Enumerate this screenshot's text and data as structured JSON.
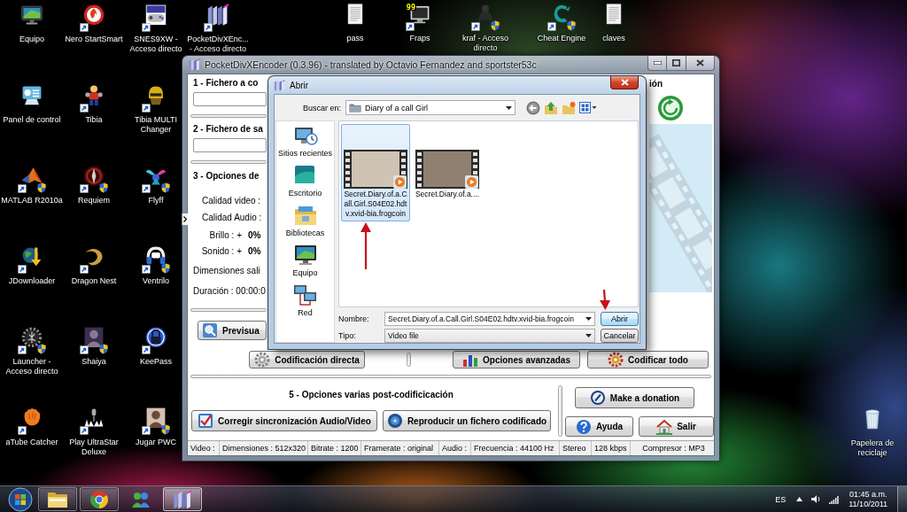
{
  "desktop_icons": [
    {
      "label": "Equipo",
      "shortcut": false,
      "shield": false
    },
    {
      "label": "Panel de control",
      "shortcut": false,
      "shield": false
    },
    {
      "label": "MATLAB R2010a",
      "shortcut": true,
      "shield": true
    },
    {
      "label": "JDownloader",
      "shortcut": true,
      "shield": false
    },
    {
      "label": "Launcher - Acceso directo",
      "shortcut": true,
      "shield": true
    },
    {
      "label": "aTube Catcher",
      "shortcut": true,
      "shield": false
    },
    {
      "label": "Nero StartSmart",
      "shortcut": true,
      "shield": false
    },
    {
      "label": "Tibia",
      "shortcut": true,
      "shield": false
    },
    {
      "label": "Requiem",
      "shortcut": true,
      "shield": true
    },
    {
      "label": "Dragon Nest",
      "shortcut": true,
      "shield": false
    },
    {
      "label": "Shaiya",
      "shortcut": true,
      "shield": true
    },
    {
      "label": "Play UltraStar Deluxe",
      "shortcut": true,
      "shield": false
    },
    {
      "label": "SNES9XW - Acceso directo",
      "shortcut": true,
      "shield": false
    },
    {
      "label": "Tibia MULTI Changer",
      "shortcut": true,
      "shield": false
    },
    {
      "label": "Flyff",
      "shortcut": true,
      "shield": true
    },
    {
      "label": "Ventrilo",
      "shortcut": true,
      "shield": true
    },
    {
      "label": "KeePass",
      "shortcut": true,
      "shield": false
    },
    {
      "label": "Jugar PWC",
      "shortcut": true,
      "shield": true
    },
    {
      "label": "PocketDivXEnc... - Acceso directo",
      "shortcut": true,
      "shield": false
    }
  ],
  "top_icons": [
    {
      "label": "pass",
      "shortcut": false,
      "shield": false
    },
    {
      "label": "Fraps",
      "badge": "99",
      "shortcut": true,
      "shield": false
    },
    {
      "label": "kraf - Acceso directo",
      "shortcut": true,
      "shield": true
    },
    {
      "label": "Cheat Engine",
      "shortcut": true,
      "shield": true
    },
    {
      "label": "claves",
      "shortcut": false,
      "shield": false
    }
  ],
  "main_window": {
    "title": "PocketDivXEncoder (0.3.96) - translated by Octavio Fernandez and sportster53c",
    "file_sections": [
      {
        "heading": "1 - Fichero a co"
      },
      {
        "heading": "2 - Fichero de sa"
      }
    ],
    "options": {
      "heading": "3 - Opciones de",
      "quality_rows": [
        "Calidad video :",
        "Calidad Audio :"
      ],
      "adjust_rows": [
        {
          "label": "Brillo : +",
          "value": "0%"
        },
        {
          "label": "Sonido : +",
          "value": "0%"
        }
      ],
      "info_rows": [
        "Dimensiones sali",
        "Duración : 00:00:0"
      ]
    },
    "preview_button": "Previsua",
    "queue_heading": "ión",
    "action_buttons": [
      "Codificación directa",
      "Opciones avanzadas",
      "Codificar todo"
    ],
    "post_heading": "5 - Opciones varias post-codificicación",
    "post_buttons": [
      "Corregir sincronización Audio/Video",
      "Reproducir un fichero codificado"
    ],
    "donate_button": "Make a donation",
    "help_button": "Ayuda",
    "exit_button": "Salir",
    "status_bar": [
      "Video :",
      "Dimensiones : 512x320",
      "Bitrate : 1200",
      "Framerate : original",
      "Audio :",
      "Frecuencia : 44100 Hz",
      "Stereo",
      "128 kbps",
      "Compresor : MP3"
    ]
  },
  "open_dialog": {
    "title": "Abrir",
    "look_in": {
      "label": "Buscar en:",
      "value": "Diary of a call Girl"
    },
    "places": [
      "Sitios recientes",
      "Escritorio",
      "Bibliotecas",
      "Equipo",
      "Red"
    ],
    "files": [
      {
        "name": "Secret.Diary.of.a.Call.Girl.S04E02.hdtv.xvid-bia.frogcoin",
        "selected": true
      },
      {
        "name": "Secret.Diary.of.a....",
        "selected": false
      }
    ],
    "file_name": {
      "label": "Nombre:",
      "value": "Secret.Diary.of.a.Call.Girl.S04E02.hdtv.xvid-bia.frogcoin"
    },
    "file_type": {
      "label": "Tipo:",
      "value": "Video file"
    },
    "buttons": [
      {
        "label": "Abrir",
        "default": true
      },
      {
        "label": "Cancelar",
        "default": false
      }
    ]
  },
  "recycle_bin": {
    "label": "Papelera de reciclaje"
  },
  "taskbar": {
    "apps": [
      {
        "running": true,
        "selected": false
      },
      {
        "running": true,
        "selected": false
      },
      {
        "running": false,
        "selected": false
      },
      {
        "running": true,
        "selected": true
      }
    ],
    "language": "ES",
    "time": "01:45 a.m.",
    "date": "11/10/2011"
  }
}
